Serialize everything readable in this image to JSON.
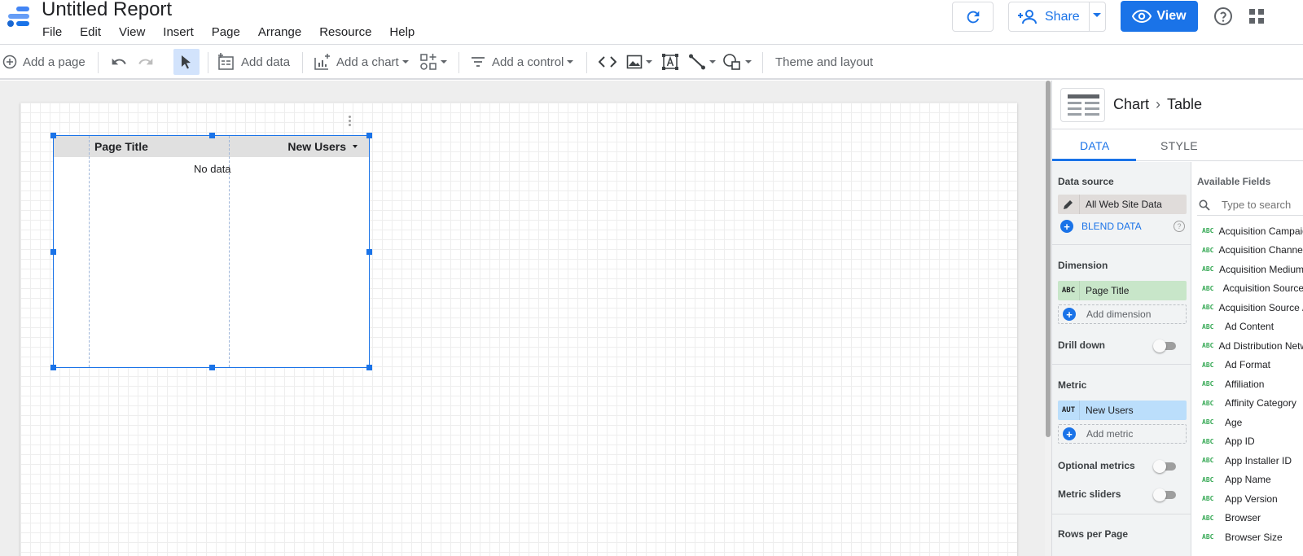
{
  "report": {
    "title": "Untitled Report"
  },
  "menu": [
    "File",
    "Edit",
    "View",
    "Insert",
    "Page",
    "Arrange",
    "Resource",
    "Help"
  ],
  "header": {
    "share_label": "Share",
    "view_label": "View"
  },
  "toolbar": {
    "add_page": "Add a page",
    "add_data": "Add data",
    "add_chart": "Add a chart",
    "add_control": "Add a control",
    "theme_layout": "Theme and layout"
  },
  "table_widget": {
    "columns": [
      "Page Title",
      "New Users"
    ],
    "empty_text": "No data"
  },
  "panel": {
    "breadcrumb": {
      "parent": "Chart",
      "child": "Table"
    },
    "tabs": [
      "DATA",
      "STYLE"
    ],
    "data_source_label": "Data source",
    "data_source_value": "All Web Site Data",
    "blend_label": "BLEND DATA",
    "dimension_label": "Dimension",
    "dimension": {
      "tag": "ABC",
      "value": "Page Title"
    },
    "add_dimension": "Add dimension",
    "drill_down": "Drill down",
    "metric_label": "Metric",
    "metric": {
      "tag": "AUT",
      "value": "New Users"
    },
    "add_metric": "Add metric",
    "optional_metrics": "Optional metrics",
    "metric_sliders": "Metric sliders",
    "rows_per_page": "Rows per Page",
    "available_fields_label": "Available Fields",
    "search_placeholder": "Type to search",
    "field_tag": "ABC",
    "fields": [
      "Acquisition Campaign",
      "Acquisition Channel",
      "Acquisition Medium",
      "Acquisition Source",
      "Acquisition Source / Medium",
      "Ad Content",
      "Ad Distribution Network",
      "Ad Format",
      "Affiliation",
      "Affinity Category",
      "Age",
      "App ID",
      "App Installer ID",
      "App Name",
      "App Version",
      "Browser",
      "Browser Size"
    ]
  },
  "colors": {
    "accent": "#1a73e8",
    "dimension_chip": "#c8e6c9",
    "metric_chip": "#bbdefb"
  }
}
